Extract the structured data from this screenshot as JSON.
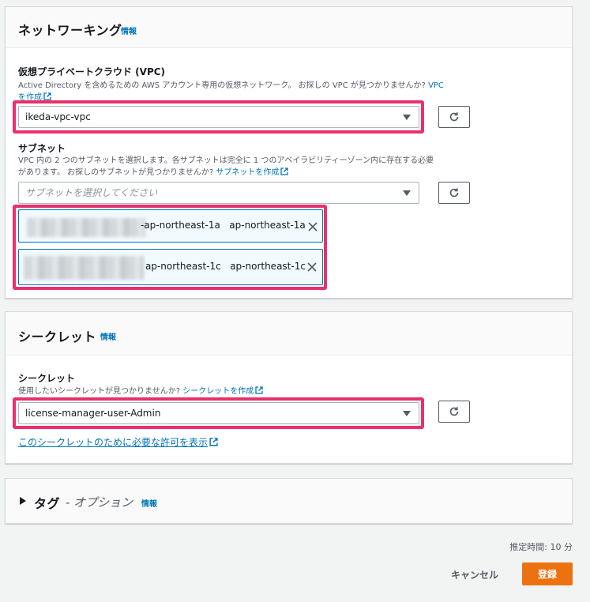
{
  "networking": {
    "title": "ネットワーキング",
    "info": "情報",
    "vpc": {
      "label": "仮想プライベートクラウド (VPC)",
      "desc_line1_pre": "Active Directory を含めるための AWS アカウント専用の仮想ネットワーク。 お探しの VPC が見つかりませんか?",
      "desc_link_a": "VPC",
      "desc_link_b": "を作成",
      "selected": "ikeda-vpc-vpc"
    },
    "subnet": {
      "label": "サブネット",
      "desc_line1": "VPC 内の 2 つのサブネットを選択します。各サブネットは完全に 1 つのアベイラビリティーゾーン内に存在する必要",
      "desc_line2_pre": "があります。 お探しのサブネットが見つかりませんか?",
      "desc_link": "サブネットを作成",
      "placeholder": "サブネットを選択してください",
      "tokens": [
        {
          "text": "-ap-northeast-1a   ap-northeast-1a"
        },
        {
          "text": "ap-northeast-1c   ap-northeast-1c"
        }
      ]
    }
  },
  "secret": {
    "title": "シークレット",
    "info": "情報",
    "label": "シークレット",
    "desc_pre": "使用したいシークレットが見つかりませんか?",
    "desc_link": "シークレットを作成",
    "selected": "license-manager-user-Admin",
    "perm_link": "このシークレットのために必要な許可を表示"
  },
  "tags": {
    "title": "タグ",
    "optional": "- オプション",
    "info": "情報"
  },
  "footer": {
    "estimate": "推定時間: 10 分",
    "cancel": "キャンセル",
    "submit": "登録"
  },
  "colors": {
    "link": "#0073bb",
    "highlight": "#e8316b",
    "primary": "#ec7211"
  }
}
